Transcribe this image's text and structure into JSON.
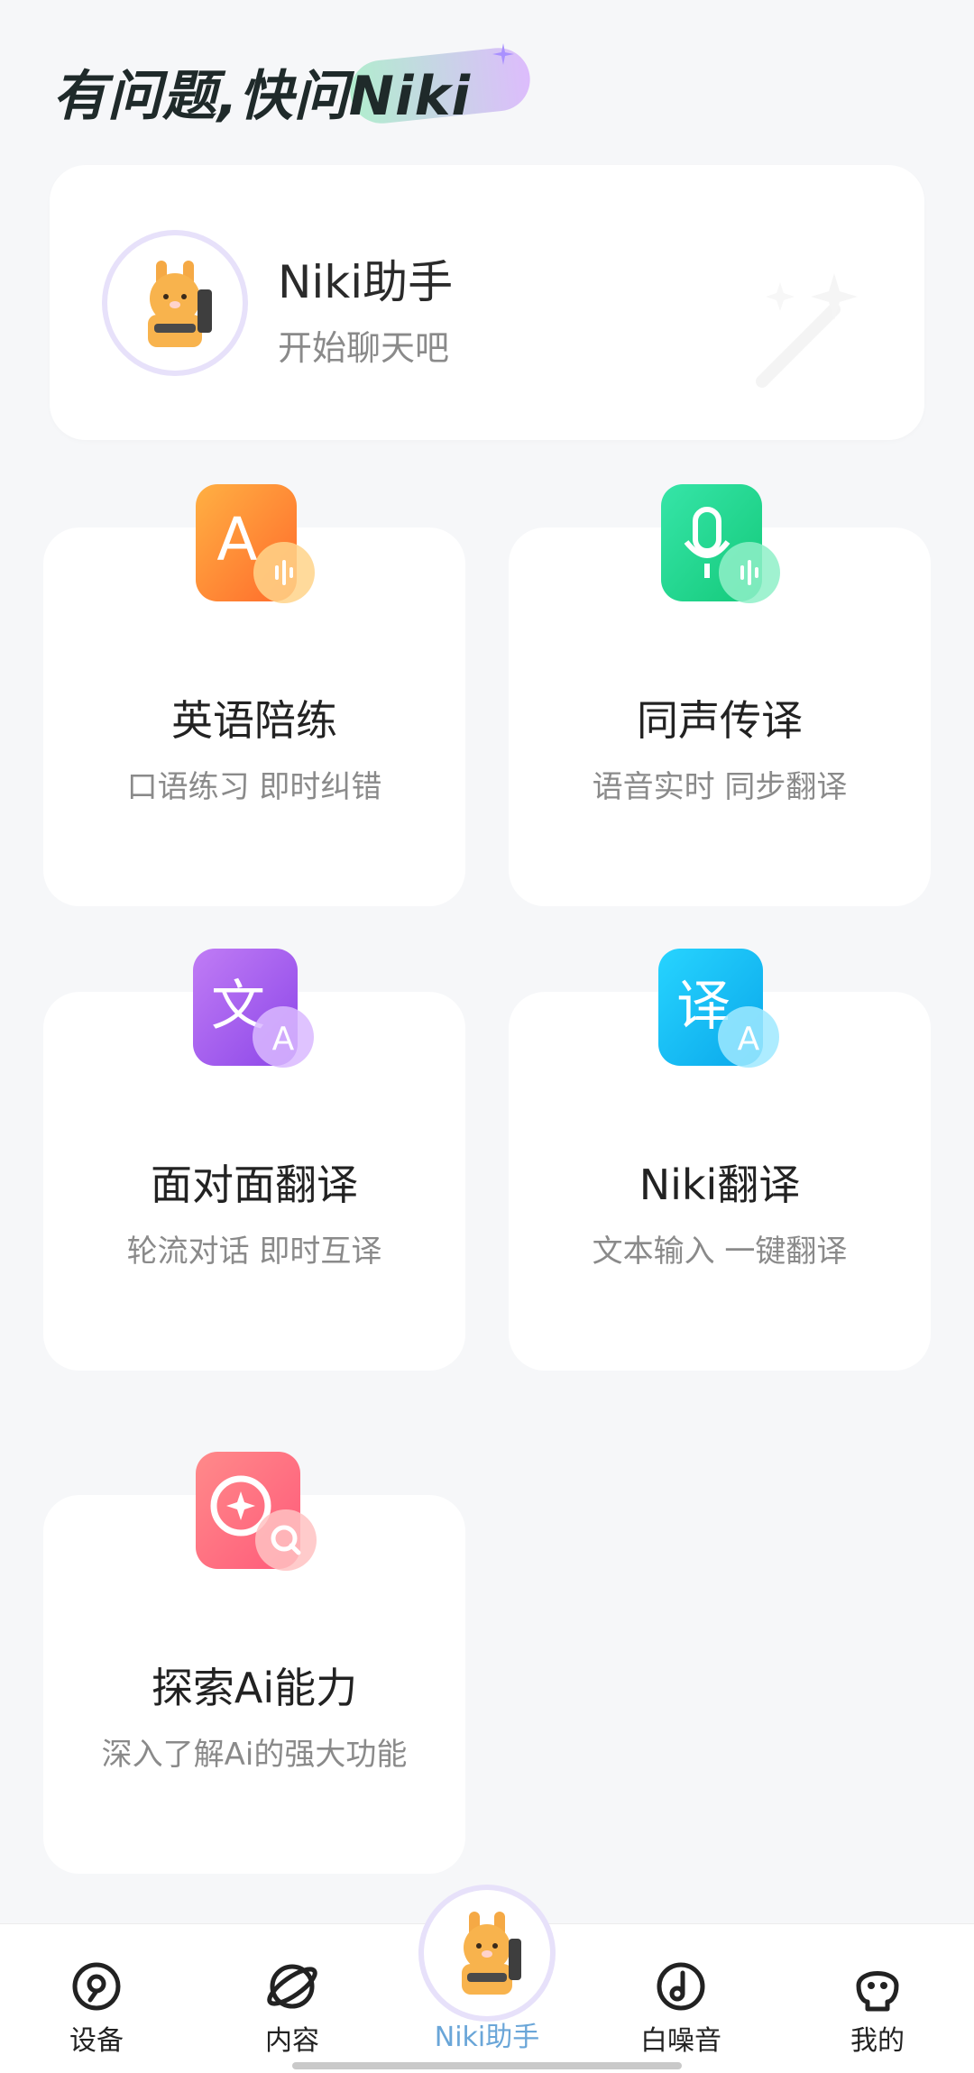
{
  "header": {
    "title_part1": "有问题,快问",
    "title_part2": "Niki"
  },
  "assistant": {
    "name": "Niki助手",
    "subtitle": "开始聊天吧"
  },
  "features": [
    {
      "title": "英语陪练",
      "subtitle": "口语练习 即时纠错",
      "icon": "english-practice-icon",
      "color": "#ff7a3c"
    },
    {
      "title": "同声传译",
      "subtitle": "语音实时 同步翻译",
      "icon": "simultaneous-interpretation-icon",
      "color": "#19d88d"
    },
    {
      "title": "面对面翻译",
      "subtitle": "轮流对话 即时互译",
      "icon": "face-to-face-translation-icon",
      "color": "#a85cf2"
    },
    {
      "title": "Niki翻译",
      "subtitle": "文本输入 一键翻译",
      "icon": "niki-translation-icon",
      "color": "#12b8f2"
    },
    {
      "title": "探索Ai能力",
      "subtitle": "深入了解Ai的强大功能",
      "icon": "explore-ai-icon",
      "color": "#ff6b6b"
    }
  ],
  "nav": {
    "items": [
      {
        "label": "设备",
        "icon": "device-icon"
      },
      {
        "label": "内容",
        "icon": "content-icon"
      },
      {
        "label": "Niki助手",
        "icon": "niki-avatar-icon"
      },
      {
        "label": "白噪音",
        "icon": "white-noise-icon"
      },
      {
        "label": "我的",
        "icon": "profile-icon"
      }
    ],
    "active_color": "#6aa6d8"
  }
}
